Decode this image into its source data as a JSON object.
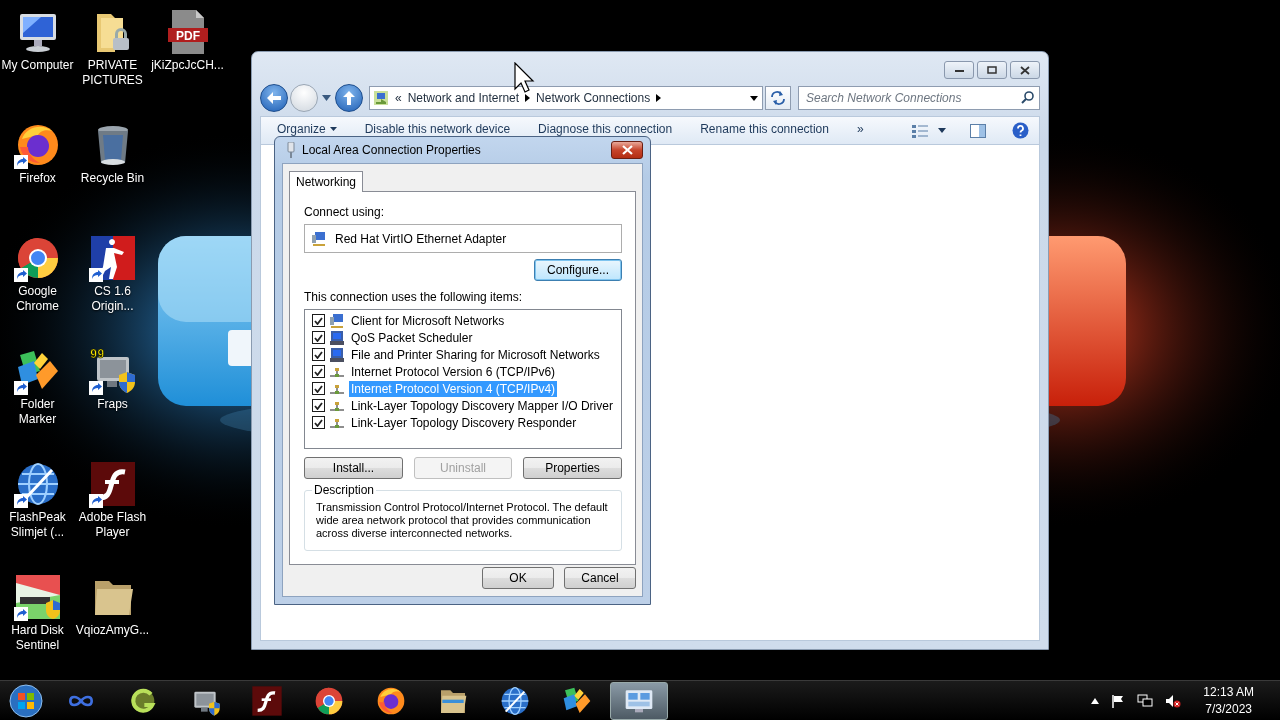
{
  "desktop_icons": [
    [
      {
        "label": "My Computer",
        "kind": "computer",
        "shortcut": false
      },
      {
        "label": "Firefox",
        "kind": "firefox",
        "shortcut": true
      },
      {
        "label": "Google Chrome",
        "kind": "chrome",
        "shortcut": true
      },
      {
        "label": "Folder Marker",
        "kind": "folder-marker",
        "shortcut": true
      },
      {
        "label": "FlashPeak Slimjet (...",
        "kind": "globe",
        "shortcut": true
      },
      {
        "label": "Hard Disk Sentinel",
        "kind": "disk",
        "shortcut": true
      }
    ],
    [
      {
        "label": "PRIVATE PICTURES",
        "kind": "locked-folder",
        "shortcut": false
      },
      {
        "label": "Recycle Bin",
        "kind": "recycle",
        "shortcut": false
      },
      {
        "label": "CS 1.6 Origin...",
        "kind": "game",
        "shortcut": true
      },
      {
        "label": "Fraps",
        "kind": "fraps",
        "badge": "99",
        "shortcut": true
      },
      {
        "label": "Adobe Flash Player",
        "kind": "flash",
        "shortcut": true
      },
      {
        "label": "VqiozAmyG...",
        "kind": "folder",
        "shortcut": false
      }
    ],
    [
      {
        "label": "jKiZpcJcCH...",
        "kind": "pdf",
        "badge": "PDF",
        "shortcut": false
      }
    ]
  ],
  "explorer": {
    "breadcrumb": {
      "overflow": "«",
      "parts": [
        "Network and Internet",
        "Network Connections"
      ]
    },
    "search": {
      "placeholder": "Search Network Connections"
    },
    "toolbar": {
      "items": [
        {
          "label": "Organize",
          "dropdown": true
        },
        {
          "label": "Disable this network device",
          "dropdown": false
        },
        {
          "label": "Diagnose this connection",
          "dropdown": false
        },
        {
          "label": "Rename this connection",
          "dropdown": false
        }
      ],
      "more": "»"
    }
  },
  "dialog": {
    "title": "Local Area Connection Properties",
    "tabs": [
      {
        "label": "Networking",
        "selected": true
      }
    ],
    "connect_label": "Connect using:",
    "adapter": "Red Hat VirtIO Ethernet Adapter",
    "configure": {
      "label": "Configure...",
      "focused": true
    },
    "items_label": "This connection uses the following items:",
    "items": [
      {
        "label": "Client for Microsoft Networks",
        "kind": "client",
        "checked": true,
        "selected": false
      },
      {
        "label": "QoS Packet Scheduler",
        "kind": "service",
        "checked": true,
        "selected": false
      },
      {
        "label": "File and Printer Sharing for Microsoft Networks",
        "kind": "service",
        "checked": true,
        "selected": false
      },
      {
        "label": "Internet Protocol Version 6 (TCP/IPv6)",
        "kind": "protocol",
        "checked": true,
        "selected": false
      },
      {
        "label": "Internet Protocol Version 4 (TCP/IPv4)",
        "kind": "protocol",
        "checked": true,
        "selected": true
      },
      {
        "label": "Link-Layer Topology Discovery Mapper I/O Driver",
        "kind": "protocol",
        "checked": true,
        "selected": false
      },
      {
        "label": "Link-Layer Topology Discovery Responder",
        "kind": "protocol",
        "checked": true,
        "selected": false
      }
    ],
    "item_buttons": [
      {
        "label": "Install...",
        "disabled": false
      },
      {
        "label": "Uninstall",
        "disabled": true
      },
      {
        "label": "Properties",
        "disabled": false
      }
    ],
    "description": {
      "title": "Description",
      "text": "Transmission Control Protocol/Internet Protocol. The default wide area network protocol that provides communication across diverse interconnected networks."
    },
    "buttons": [
      "OK",
      "Cancel"
    ]
  },
  "taskbar": {
    "items": [
      {
        "kind": "infinity",
        "selected": false
      },
      {
        "kind": "ring",
        "selected": false
      },
      {
        "kind": "fraps",
        "selected": false
      },
      {
        "kind": "flash",
        "selected": false
      },
      {
        "kind": "chrome",
        "selected": false
      },
      {
        "kind": "firefox",
        "selected": false
      },
      {
        "kind": "explorer",
        "selected": false
      },
      {
        "kind": "globe",
        "selected": false
      },
      {
        "kind": "folder-marker",
        "selected": false
      },
      {
        "kind": "control-panel",
        "selected": true
      }
    ],
    "clock": {
      "time": "12:13 AM",
      "date": "7/3/2023"
    }
  }
}
